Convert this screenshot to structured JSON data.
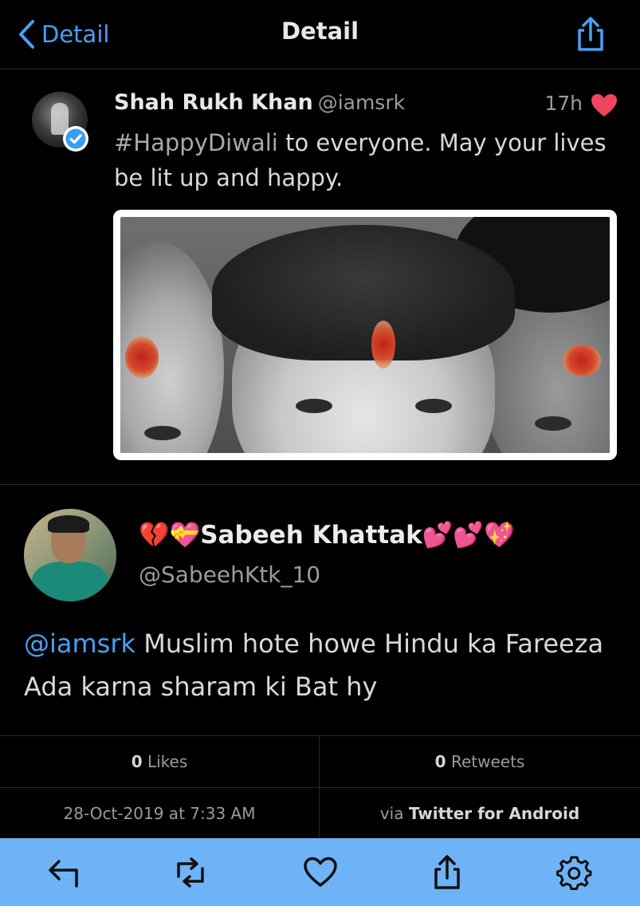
{
  "nav": {
    "back_label": "Detail",
    "title": "Detail"
  },
  "quoted_tweet": {
    "author_name": "Shah Rukh Khan",
    "handle": "@iamsrk",
    "time": "17h",
    "hashtag": "#HappyDiwali",
    "text": " to everyone. May your lives be lit up and happy."
  },
  "reply": {
    "name_prefix_emoji": [
      "💔",
      "💝"
    ],
    "name": "Sabeeh Khattak",
    "name_suffix_emoji": [
      "💕",
      "💕",
      "💖"
    ],
    "handle": "@SabeehKtk_10",
    "mention": "@iamsrk",
    "text": " Muslim hote howe Hindu ka Fareeza Ada karna sharam ki Bat hy"
  },
  "stats": {
    "likes_count": "0",
    "likes_label": "Likes",
    "retweets_count": "0",
    "retweets_label": "Retweets",
    "date": "28-Oct-2019 at 7:33 AM",
    "via_prefix": "via",
    "client": "Twitter for Android"
  },
  "toolbar": {
    "icons": [
      "reply-icon",
      "retweet-icon",
      "like-icon",
      "share-icon",
      "settings-icon"
    ]
  },
  "colors": {
    "accent": "#4a9ff5",
    "toolbar_bg": "#6fb3f7",
    "heart": "#f0455f"
  }
}
